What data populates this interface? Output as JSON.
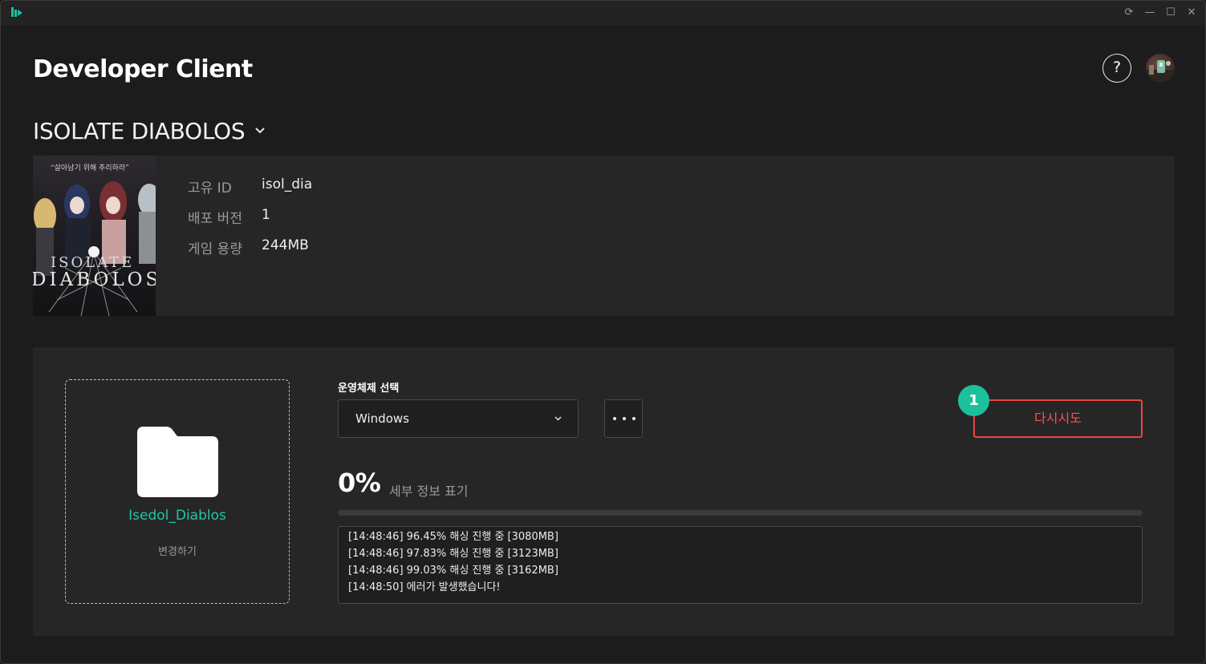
{
  "window": {
    "controls": [
      "⟳",
      "—",
      "☐",
      "✕"
    ]
  },
  "header": {
    "title": "Developer Client",
    "help_label": "?"
  },
  "project": {
    "name": "ISOLATE DIABOLOS"
  },
  "game": {
    "cover_tagline": "“살아남기 위해 추리하라”",
    "cover_title_line1": "ISOLATE",
    "cover_title_line2": "DIABOLOS",
    "meta": [
      {
        "label": "고유 ID",
        "value": "isol_dia"
      },
      {
        "label": "배포 버전",
        "value": "1"
      },
      {
        "label": "게임 용량",
        "value": "244MB"
      }
    ]
  },
  "build": {
    "folder_name": "Isedol_Diablos",
    "change_label": "변경하기",
    "os_label": "운영체제 선택",
    "os_value": "Windows",
    "retry_label": "다시시도",
    "step_number": "1",
    "percent_label": "0%",
    "progress": 0,
    "details_label": "세부 정보 표기",
    "logs": [
      "[14:48:46] 96.45% 해싱 진행 중 [3080MB]",
      "[14:48:46] 97.83% 해싱 진행 중 [3123MB]",
      "[14:48:46] 99.03% 해싱 진행 중 [3162MB]",
      "[14:48:50] 에러가 발생했습니다!"
    ]
  },
  "colors": {
    "accent": "#1cc19c",
    "danger": "#e84545",
    "background": "#1c1c1c",
    "panel": "#262626"
  }
}
